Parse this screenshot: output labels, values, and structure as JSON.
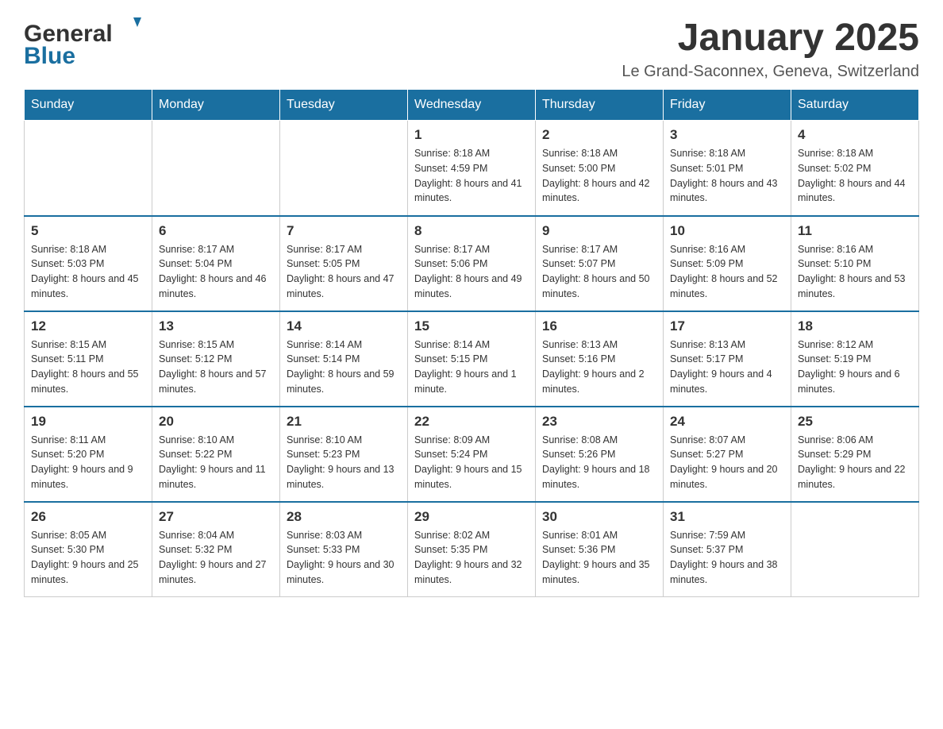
{
  "header": {
    "logo_general": "General",
    "logo_blue": "Blue",
    "title": "January 2025",
    "location": "Le Grand-Saconnex, Geneva, Switzerland"
  },
  "days_of_week": [
    "Sunday",
    "Monday",
    "Tuesday",
    "Wednesday",
    "Thursday",
    "Friday",
    "Saturday"
  ],
  "weeks": [
    {
      "days": [
        {
          "number": "",
          "info": ""
        },
        {
          "number": "",
          "info": ""
        },
        {
          "number": "",
          "info": ""
        },
        {
          "number": "1",
          "sunrise": "Sunrise: 8:18 AM",
          "sunset": "Sunset: 4:59 PM",
          "daylight": "Daylight: 8 hours and 41 minutes."
        },
        {
          "number": "2",
          "sunrise": "Sunrise: 8:18 AM",
          "sunset": "Sunset: 5:00 PM",
          "daylight": "Daylight: 8 hours and 42 minutes."
        },
        {
          "number": "3",
          "sunrise": "Sunrise: 8:18 AM",
          "sunset": "Sunset: 5:01 PM",
          "daylight": "Daylight: 8 hours and 43 minutes."
        },
        {
          "number": "4",
          "sunrise": "Sunrise: 8:18 AM",
          "sunset": "Sunset: 5:02 PM",
          "daylight": "Daylight: 8 hours and 44 minutes."
        }
      ]
    },
    {
      "days": [
        {
          "number": "5",
          "sunrise": "Sunrise: 8:18 AM",
          "sunset": "Sunset: 5:03 PM",
          "daylight": "Daylight: 8 hours and 45 minutes."
        },
        {
          "number": "6",
          "sunrise": "Sunrise: 8:17 AM",
          "sunset": "Sunset: 5:04 PM",
          "daylight": "Daylight: 8 hours and 46 minutes."
        },
        {
          "number": "7",
          "sunrise": "Sunrise: 8:17 AM",
          "sunset": "Sunset: 5:05 PM",
          "daylight": "Daylight: 8 hours and 47 minutes."
        },
        {
          "number": "8",
          "sunrise": "Sunrise: 8:17 AM",
          "sunset": "Sunset: 5:06 PM",
          "daylight": "Daylight: 8 hours and 49 minutes."
        },
        {
          "number": "9",
          "sunrise": "Sunrise: 8:17 AM",
          "sunset": "Sunset: 5:07 PM",
          "daylight": "Daylight: 8 hours and 50 minutes."
        },
        {
          "number": "10",
          "sunrise": "Sunrise: 8:16 AM",
          "sunset": "Sunset: 5:09 PM",
          "daylight": "Daylight: 8 hours and 52 minutes."
        },
        {
          "number": "11",
          "sunrise": "Sunrise: 8:16 AM",
          "sunset": "Sunset: 5:10 PM",
          "daylight": "Daylight: 8 hours and 53 minutes."
        }
      ]
    },
    {
      "days": [
        {
          "number": "12",
          "sunrise": "Sunrise: 8:15 AM",
          "sunset": "Sunset: 5:11 PM",
          "daylight": "Daylight: 8 hours and 55 minutes."
        },
        {
          "number": "13",
          "sunrise": "Sunrise: 8:15 AM",
          "sunset": "Sunset: 5:12 PM",
          "daylight": "Daylight: 8 hours and 57 minutes."
        },
        {
          "number": "14",
          "sunrise": "Sunrise: 8:14 AM",
          "sunset": "Sunset: 5:14 PM",
          "daylight": "Daylight: 8 hours and 59 minutes."
        },
        {
          "number": "15",
          "sunrise": "Sunrise: 8:14 AM",
          "sunset": "Sunset: 5:15 PM",
          "daylight": "Daylight: 9 hours and 1 minute."
        },
        {
          "number": "16",
          "sunrise": "Sunrise: 8:13 AM",
          "sunset": "Sunset: 5:16 PM",
          "daylight": "Daylight: 9 hours and 2 minutes."
        },
        {
          "number": "17",
          "sunrise": "Sunrise: 8:13 AM",
          "sunset": "Sunset: 5:17 PM",
          "daylight": "Daylight: 9 hours and 4 minutes."
        },
        {
          "number": "18",
          "sunrise": "Sunrise: 8:12 AM",
          "sunset": "Sunset: 5:19 PM",
          "daylight": "Daylight: 9 hours and 6 minutes."
        }
      ]
    },
    {
      "days": [
        {
          "number": "19",
          "sunrise": "Sunrise: 8:11 AM",
          "sunset": "Sunset: 5:20 PM",
          "daylight": "Daylight: 9 hours and 9 minutes."
        },
        {
          "number": "20",
          "sunrise": "Sunrise: 8:10 AM",
          "sunset": "Sunset: 5:22 PM",
          "daylight": "Daylight: 9 hours and 11 minutes."
        },
        {
          "number": "21",
          "sunrise": "Sunrise: 8:10 AM",
          "sunset": "Sunset: 5:23 PM",
          "daylight": "Daylight: 9 hours and 13 minutes."
        },
        {
          "number": "22",
          "sunrise": "Sunrise: 8:09 AM",
          "sunset": "Sunset: 5:24 PM",
          "daylight": "Daylight: 9 hours and 15 minutes."
        },
        {
          "number": "23",
          "sunrise": "Sunrise: 8:08 AM",
          "sunset": "Sunset: 5:26 PM",
          "daylight": "Daylight: 9 hours and 18 minutes."
        },
        {
          "number": "24",
          "sunrise": "Sunrise: 8:07 AM",
          "sunset": "Sunset: 5:27 PM",
          "daylight": "Daylight: 9 hours and 20 minutes."
        },
        {
          "number": "25",
          "sunrise": "Sunrise: 8:06 AM",
          "sunset": "Sunset: 5:29 PM",
          "daylight": "Daylight: 9 hours and 22 minutes."
        }
      ]
    },
    {
      "days": [
        {
          "number": "26",
          "sunrise": "Sunrise: 8:05 AM",
          "sunset": "Sunset: 5:30 PM",
          "daylight": "Daylight: 9 hours and 25 minutes."
        },
        {
          "number": "27",
          "sunrise": "Sunrise: 8:04 AM",
          "sunset": "Sunset: 5:32 PM",
          "daylight": "Daylight: 9 hours and 27 minutes."
        },
        {
          "number": "28",
          "sunrise": "Sunrise: 8:03 AM",
          "sunset": "Sunset: 5:33 PM",
          "daylight": "Daylight: 9 hours and 30 minutes."
        },
        {
          "number": "29",
          "sunrise": "Sunrise: 8:02 AM",
          "sunset": "Sunset: 5:35 PM",
          "daylight": "Daylight: 9 hours and 32 minutes."
        },
        {
          "number": "30",
          "sunrise": "Sunrise: 8:01 AM",
          "sunset": "Sunset: 5:36 PM",
          "daylight": "Daylight: 9 hours and 35 minutes."
        },
        {
          "number": "31",
          "sunrise": "Sunrise: 7:59 AM",
          "sunset": "Sunset: 5:37 PM",
          "daylight": "Daylight: 9 hours and 38 minutes."
        },
        {
          "number": "",
          "info": ""
        }
      ]
    }
  ]
}
